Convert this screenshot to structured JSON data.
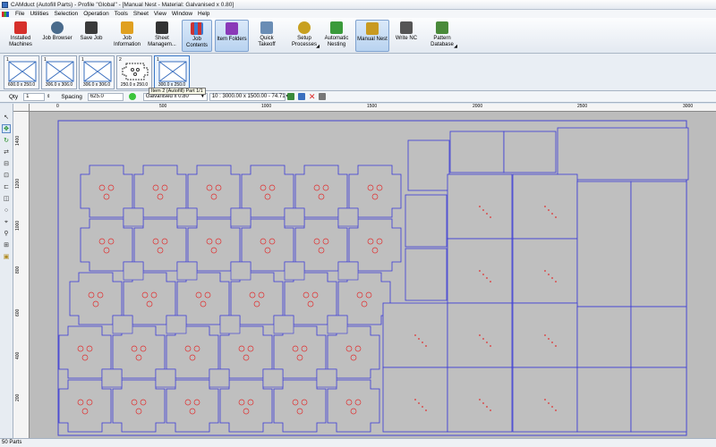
{
  "window": {
    "title": "CAMduct (Autofill Parts) - Profile \"Global\" - [Manual Nest - Material: Galvanised x 0.80]"
  },
  "menubar": {
    "items": [
      "File",
      "Utilities",
      "Selection",
      "Operation",
      "Tools",
      "Sheet",
      "View",
      "Window",
      "Help"
    ]
  },
  "ribbon": {
    "buttons": [
      {
        "label": "Installed\nMachines",
        "icon": "machine-icon",
        "color": "#d6302b"
      },
      {
        "label": "Job Browser",
        "icon": "job-browser-icon",
        "color": "#4a6b8c"
      },
      {
        "label": "Save Job",
        "icon": "save-icon",
        "color": "#3a3a3a"
      },
      {
        "label": "Job\nInformation",
        "icon": "info-icon",
        "color": "#e0a020"
      },
      {
        "label": "Sheet\nManagem...",
        "icon": "sheet-icon",
        "color": "#333333"
      },
      {
        "label": "Job\nContents",
        "icon": "job-contents-icon",
        "color": "#cc3333"
      },
      {
        "label": "Item Folders",
        "icon": "item-folders-icon",
        "color": "#8a3ab8"
      },
      {
        "label": "Quick\nTakeoff",
        "icon": "quick-takeoff-icon",
        "color": "#6a8db5"
      },
      {
        "label": "Setup\nProcesses",
        "icon": "setup-icon",
        "color": "#c8a020"
      },
      {
        "label": "Automatic\nNesting",
        "icon": "auto-nest-icon",
        "color": "#3a9a3a"
      },
      {
        "label": "Manual Nest",
        "icon": "manual-nest-icon",
        "color": "#c89a20"
      },
      {
        "label": "Write NC",
        "icon": "write-nc-icon",
        "color": "#555555"
      },
      {
        "label": "Pattern\nDatabase",
        "icon": "pattern-db-icon",
        "color": "#4a8a3a"
      }
    ]
  },
  "thumbnails": [
    {
      "num": "1",
      "size": "600.0 x 250.0"
    },
    {
      "num": "1",
      "size": "306.0 x 306.0"
    },
    {
      "num": "1",
      "size": "306.0 x 306.0"
    },
    {
      "num": "2",
      "size": "250.0 x 250.0"
    },
    {
      "num": "1",
      "size": "300.0 x 250.0"
    }
  ],
  "tooltip": "Item 2 (Autofill) Part 1/1",
  "optbar": {
    "qty_label": "Qty",
    "qty_value": "1",
    "spacing_label": "Spacing",
    "spacing_value": "625.0",
    "material": "Galvanised x 0.80",
    "sheet": "10 : 3000.00 x 1500.00 - 74.71"
  },
  "rulers": {
    "x_ticks": [
      "0",
      "500",
      "1000",
      "1500",
      "2000",
      "2500",
      "3000"
    ],
    "y_ticks": [
      "1400",
      "1200",
      "1000",
      "800",
      "600",
      "400",
      "200"
    ]
  },
  "status": "50 Parts",
  "colors": {
    "part_outline": "#3a3ad8",
    "hole": "#e03030",
    "canvas": "#bcbcbc",
    "sheet": "#bfbfbf"
  }
}
